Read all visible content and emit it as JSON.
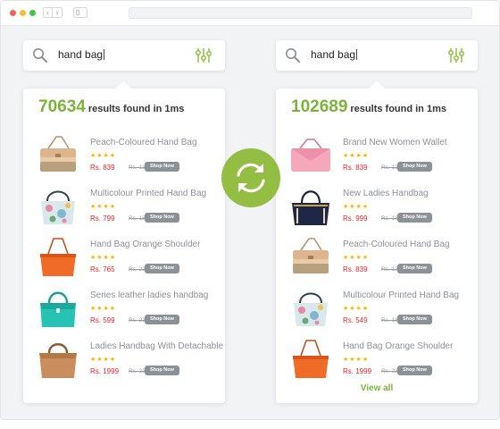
{
  "colors": {
    "accent": "#7db33a",
    "price": "#e8242f",
    "shop_button": "#8c9196",
    "sync_circle": "#93bd43",
    "stars": "#f5b800"
  },
  "left": {
    "search": {
      "query": "hand bag",
      "icons": [
        "search-icon",
        "filter-sliders-icon"
      ]
    },
    "results": {
      "count": "70634",
      "text": "results found in 1ms"
    },
    "products": [
      {
        "name": "Peach-Coloured Hand Bag",
        "stars": "★★★★",
        "price": "Rs. 839",
        "mrp": "Rs. 1399",
        "cta": "Shop Now",
        "image": "peach-bag"
      },
      {
        "name": "Multicolour Printed Hand Bag",
        "stars": "★★★★",
        "price": "Rs. 799",
        "mrp": "Rs. 1899",
        "cta": "Shop Now",
        "image": "floral-bag"
      },
      {
        "name": "Hand Bag Orange Shoulder",
        "stars": "★★★★",
        "price": "Rs. 765",
        "mrp": "Rs. 2399",
        "cta": "Shop Now",
        "image": "orange-bag"
      },
      {
        "name": "Series leather ladies handbag",
        "stars": "★★★★",
        "price": "Rs. 599",
        "mrp": "Rs. 2399",
        "cta": "Shop Now",
        "image": "teal-bag"
      },
      {
        "name": "Ladies Handbag With Detachable",
        "stars": "★★★★",
        "price": "Rs. 1999",
        "mrp": "Rs. 2399",
        "cta": "Shop Now",
        "image": "tan-bag"
      }
    ]
  },
  "right": {
    "search": {
      "query": "hand bag",
      "icons": [
        "search-icon",
        "filter-sliders-icon"
      ]
    },
    "results": {
      "count": "102689",
      "text": "results found in 1ms"
    },
    "products": [
      {
        "name": "Brand New Women Wallet",
        "stars": "★★★★",
        "price": "Rs. 839",
        "mrp": "Rs. 1399",
        "cta": "Shop Now",
        "image": "pink-wallet"
      },
      {
        "name": "New Ladies Handbag",
        "stars": "★★★★",
        "price": "Rs. 999",
        "mrp": "Rs. 1899",
        "cta": "Shop Now",
        "image": "navy-bag"
      },
      {
        "name": "Peach-Coloured Hand Bag",
        "stars": "★★★★",
        "price": "Rs. 839",
        "mrp": "Rs. 1399",
        "cta": "Shop Now",
        "image": "peach-bag"
      },
      {
        "name": "Multicolour Printed Hand Bag",
        "stars": "★★★★",
        "price": "Rs. 549",
        "mrp": "Rs. 1899",
        "cta": "Shop Now",
        "image": "floral-bag"
      },
      {
        "name": "Hand Bag Orange Shoulder",
        "stars": "★★★★",
        "price": "Rs. 1999",
        "mrp": "Rs. 2399",
        "cta": "Shop Now",
        "image": "orange-bag"
      }
    ],
    "view_all": "View all"
  },
  "center": {
    "icon": "sync-icon"
  }
}
